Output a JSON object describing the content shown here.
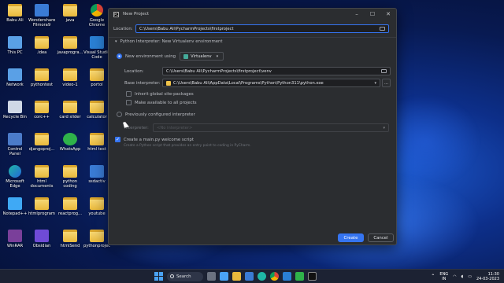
{
  "desktop": {
    "icons": [
      {
        "label": "Babu Ali",
        "type": "folder"
      },
      {
        "label": "Wondershare Filmora9",
        "type": "app"
      },
      {
        "label": "java",
        "type": "folder"
      },
      {
        "label": "Google Chrome",
        "type": "chrome"
      },
      {
        "label": "This PC",
        "type": "pc"
      },
      {
        "label": ".idea",
        "type": "folder"
      },
      {
        "label": "javaprogra...",
        "type": "folder"
      },
      {
        "label": "Visual Studio Code",
        "type": "vs"
      },
      {
        "label": "Network",
        "type": "pc"
      },
      {
        "label": "pythontest",
        "type": "folder"
      },
      {
        "label": "video-1",
        "type": "folder"
      },
      {
        "label": "portol",
        "type": "folder"
      },
      {
        "label": "Recycle Bin",
        "type": "bin"
      },
      {
        "label": "corc++",
        "type": "folder"
      },
      {
        "label": "card slider",
        "type": "folder"
      },
      {
        "label": "calculator",
        "type": "folder"
      },
      {
        "label": "Control Panel",
        "type": "ctrl"
      },
      {
        "label": "djangoproj...",
        "type": "folder"
      },
      {
        "label": "WhatsApp",
        "type": "green"
      },
      {
        "label": "html test",
        "type": "folder"
      },
      {
        "label": "Microsoft Edge",
        "type": "edge"
      },
      {
        "label": "html documents",
        "type": "folder"
      },
      {
        "label": "python coding",
        "type": "folder"
      },
      {
        "label": "ssdactiv",
        "type": "app"
      },
      {
        "label": "Notepad++",
        "type": "notepad"
      },
      {
        "label": "htmlprogram",
        "type": "folder"
      },
      {
        "label": "reactprog...",
        "type": "folder"
      },
      {
        "label": "youtube",
        "type": "folder"
      },
      {
        "label": "WinRAR",
        "type": "winrar"
      },
      {
        "label": "Obsidian",
        "type": "obs"
      },
      {
        "label": "htmlSend",
        "type": "folder"
      },
      {
        "label": "pythonprojec",
        "type": "folder"
      }
    ]
  },
  "dialog": {
    "title": "New Project",
    "location_label": "Location:",
    "location_value": "C:\\Users\\Babu Ali\\PycharmProjects\\firstproject",
    "section_title": "Python Interpreter: New Virtualenv environment",
    "new_env_label": "New environment using",
    "env_tool": "Virtualenv",
    "venv_location_label": "Location:",
    "venv_location_value": "C:\\Users\\Babu Ali\\PycharmProjects\\firstproject\\venv",
    "base_interp_label": "Base interpreter:",
    "base_interp_value": "C:\\Users\\Babu Ali\\AppData\\Local\\Programs\\Python\\Python311\\python.exe",
    "browse_label": "...",
    "inherit_label": "Inherit global site-packages",
    "available_label": "Make available to all projects",
    "previous_label": "Previously configured interpreter",
    "interpreter_label": "Interpreter:",
    "interpreter_value": "<No interpreter>",
    "welcome_label": "Create a main.py welcome script",
    "welcome_hint": "Create a Python script that provides an entry point to coding in PyCharm.",
    "create_label": "Create",
    "cancel_label": "Cancel"
  },
  "taskbar": {
    "search_label": "Search",
    "lang_line1": "ENG",
    "lang_line2": "IN",
    "time": "11:30",
    "date": "24-03-2023"
  }
}
